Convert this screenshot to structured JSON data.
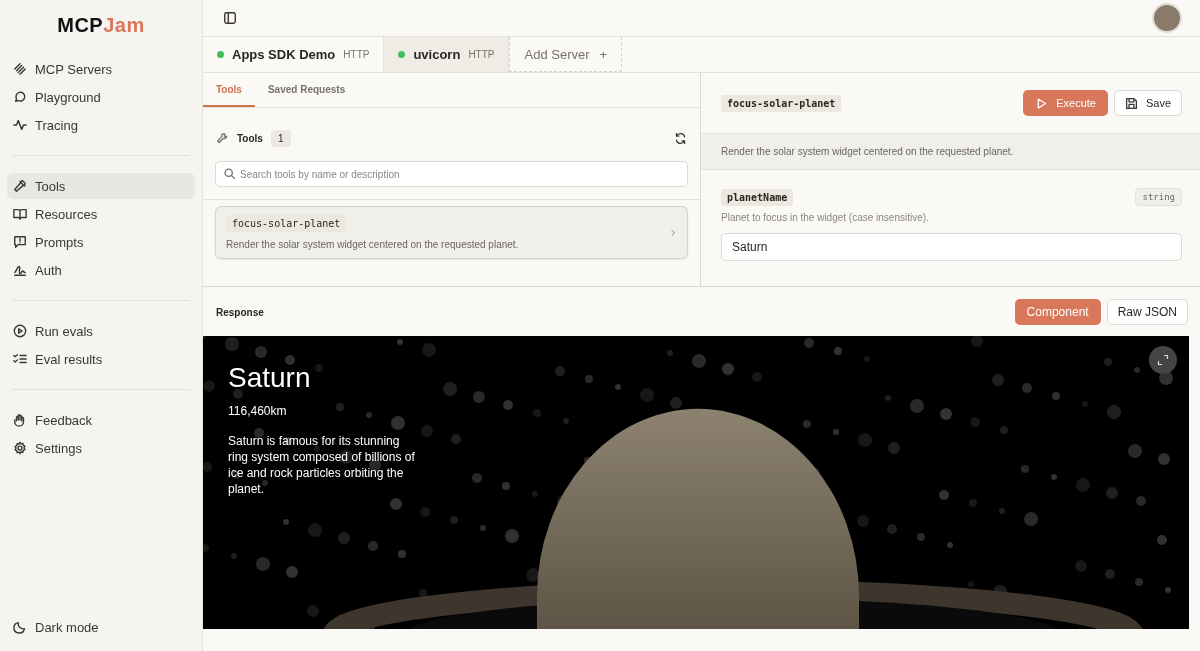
{
  "logo": {
    "part_1": "MCP",
    "part_2": "Jam"
  },
  "sidebar": {
    "groups": [
      {
        "items": [
          {
            "label": "MCP Servers",
            "selected": false
          },
          {
            "label": "Playground",
            "selected": false
          },
          {
            "label": "Tracing",
            "selected": false
          }
        ]
      },
      {
        "items": [
          {
            "label": "Tools",
            "selected": true
          },
          {
            "label": "Resources",
            "selected": false
          },
          {
            "label": "Prompts",
            "selected": false
          },
          {
            "label": "Auth",
            "selected": false
          }
        ]
      },
      {
        "items": [
          {
            "label": "Run evals",
            "selected": false
          },
          {
            "label": "Eval results",
            "selected": false
          }
        ]
      },
      {
        "items": [
          {
            "label": "Feedback",
            "selected": false
          },
          {
            "label": "Settings",
            "selected": false
          }
        ]
      }
    ],
    "footer": {
      "label": "Dark mode"
    }
  },
  "server_tabs": [
    {
      "name": "Apps SDK Demo",
      "transport": "HTTP",
      "connected": true,
      "selected": false
    },
    {
      "name": "uvicorn",
      "transport": "HTTP",
      "connected": true,
      "selected": true
    }
  ],
  "add_server": {
    "label": "Add Server",
    "icon": "+"
  },
  "subtabs": [
    {
      "label": "Tools",
      "selected": true
    },
    {
      "label": "Saved Requests",
      "selected": false
    }
  ],
  "tools_panel": {
    "title": "Tools",
    "count": "1",
    "search": {
      "placeholder": "Search tools by name or description"
    },
    "tools": [
      {
        "name": "focus-solar-planet",
        "description": "Render the solar system widget centered on the requested planet."
      }
    ]
  },
  "detail": {
    "tool_name": "focus-solar-planet",
    "execute": "Execute",
    "save": "Save",
    "description": "Render the solar system widget centered on the requested planet.",
    "params": [
      {
        "name": "planetName",
        "type": "string",
        "hint": "Planet to focus in the widget (case insensitive).",
        "value": "Saturn"
      }
    ]
  },
  "response": {
    "title": "Response",
    "views": [
      {
        "label": "Component",
        "selected": true
      },
      {
        "label": "Raw JSON",
        "selected": false
      }
    ],
    "widget": {
      "title": "Saturn",
      "distance": "116,460km",
      "text": "Saturn is famous for its stunning ring system composed of billions of ice and rock particles orbiting the planet."
    }
  }
}
